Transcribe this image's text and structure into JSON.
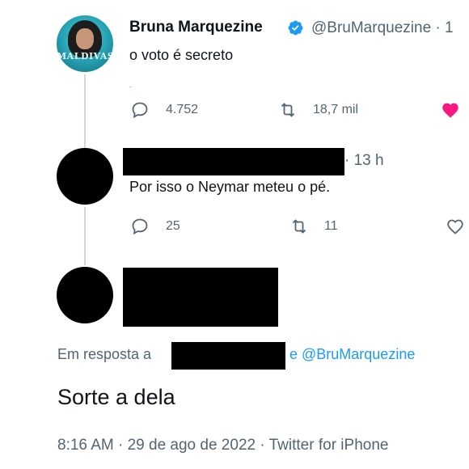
{
  "original_tweet": {
    "author_name": "Bruna Marquezine",
    "author_handle": "@BruMarquezine · 1",
    "avatar_logo_text": "MALDIVAS",
    "text": "o voto é secreto",
    "small_mark": ".",
    "replies": "4.752",
    "retweets": "18,7 mil",
    "liked": true,
    "like_color": "#f91880"
  },
  "reply_tweet": {
    "time": "· 13 h",
    "text": "Por isso o Neymar meteu o pé.",
    "replies": "25",
    "retweets": "11"
  },
  "focused_tweet": {
    "reply_to_prefix": "Em resposta a",
    "reply_to_conjunction": "e",
    "reply_to_handle": "@BruMarquezine",
    "text": "Sorte a dela",
    "meta": "8:16 AM · 29 de ago de 2022 · Twitter for iPhone"
  },
  "colors": {
    "accent": "#1d9bf0",
    "secondary_text": "#536471",
    "primary_text": "#0f1419",
    "thread_line": "#cfd9de"
  }
}
